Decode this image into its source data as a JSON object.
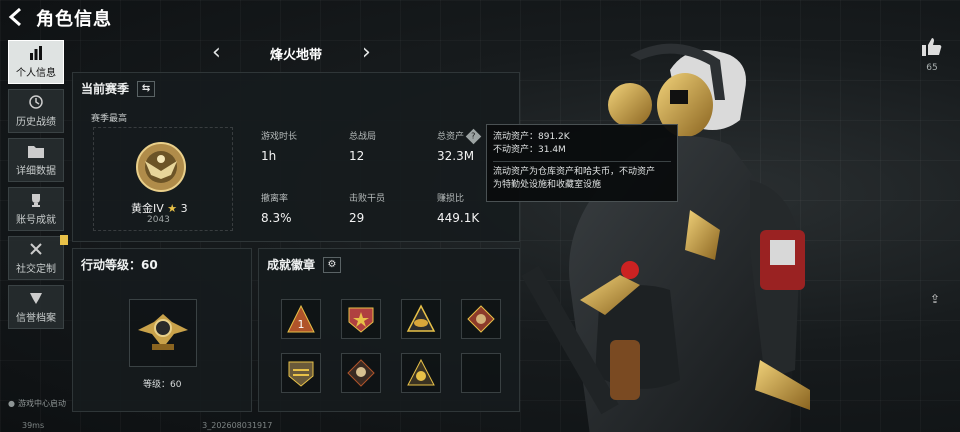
{
  "header": {
    "title": "角色信息"
  },
  "nav": {
    "items": [
      {
        "label": "个人信息",
        "icon": "bar-chart-icon",
        "active": true
      },
      {
        "label": "历史战绩",
        "icon": "history-icon"
      },
      {
        "label": "详细数据",
        "icon": "folder-icon"
      },
      {
        "label": "账号成就",
        "icon": "trophy-icon"
      },
      {
        "label": "社交定制",
        "icon": "tools-icon"
      },
      {
        "label": "信誉档案",
        "icon": "shield-icon"
      }
    ]
  },
  "status": {
    "gamecenter": "游戏中心启动",
    "ping": "39ms",
    "build": "3_202608031917"
  },
  "map": {
    "name": "烽火地带"
  },
  "season": {
    "title": "当前赛季",
    "best_label": "赛季最高",
    "rank_name": "黄金IV",
    "rank_stars": "3",
    "rank_score": "2043",
    "stats": [
      {
        "label": "游戏时长",
        "value": "1h"
      },
      {
        "label": "总战局",
        "value": "12"
      },
      {
        "label": "总资产",
        "value": "32.3M"
      },
      {
        "label": "撤离率",
        "value": "8.3%"
      },
      {
        "label": "击败干员",
        "value": "29"
      },
      {
        "label": "赚损比",
        "value": "449.1K"
      }
    ]
  },
  "tooltip": {
    "liquid": "流动资产：891.2K",
    "fixed": "不动资产：31.4M",
    "desc1": "流动资产为仓库资产和哈夫币，不动资产",
    "desc2": "为特勤处设施和收藏室设施"
  },
  "level": {
    "title": "行动等级：60",
    "text": "等级：60"
  },
  "achievements": {
    "title": "成就徽章"
  },
  "likes": {
    "count": "65"
  },
  "colors": {
    "accent_gold": "#c9a24a",
    "tooltip_bg": "#0a0c0d",
    "active_nav": "#dfe3e2"
  }
}
